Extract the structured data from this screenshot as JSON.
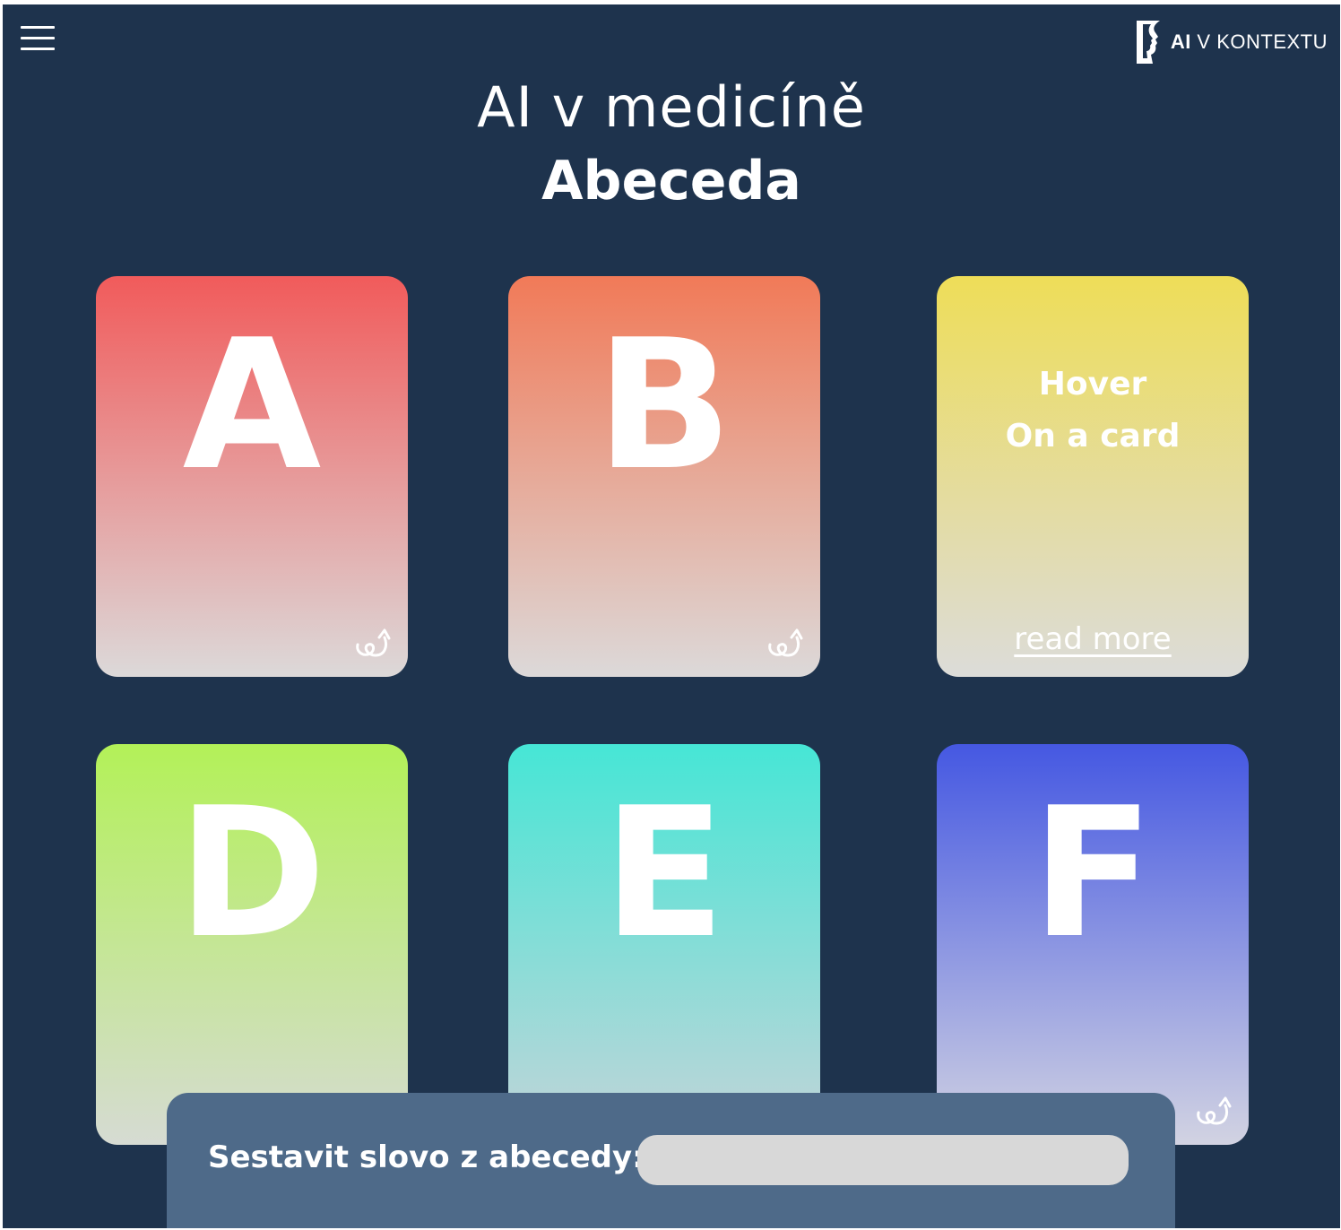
{
  "header": {
    "menu_icon": "hamburger-menu-icon",
    "logo": {
      "strong": "AI",
      "rest": " V KONTEXTU",
      "icon": "face-profile-icon"
    }
  },
  "page": {
    "title": "AI v medicíně",
    "subtitle": "Abeceda"
  },
  "cards": [
    {
      "letter": "A",
      "gradient": [
        "#f15b5b",
        "#dcd9d9"
      ],
      "icon": "flip-arrow-icon"
    },
    {
      "letter": "B",
      "gradient": [
        "#f17a58",
        "#dcd9d9"
      ],
      "icon": "flip-arrow-icon"
    },
    {
      "hover_line_1": "Hover",
      "hover_line_2": "On a card",
      "read_more": "read more",
      "gradient": [
        "#eedd58",
        "#dcdcd9"
      ]
    },
    {
      "letter": "D",
      "gradient": [
        "#b3f158",
        "#d6dbd3"
      ]
    },
    {
      "letter": "E",
      "gradient": [
        "#46e6d6",
        "#c4d4d8"
      ]
    },
    {
      "letter": "F",
      "gradient": [
        "#4558e2",
        "#d2d3e2"
      ],
      "icon": "flip-arrow-icon"
    }
  ],
  "word_builder": {
    "label": "Sestavit slovo z abecedy:",
    "value": "",
    "placeholder": ""
  }
}
